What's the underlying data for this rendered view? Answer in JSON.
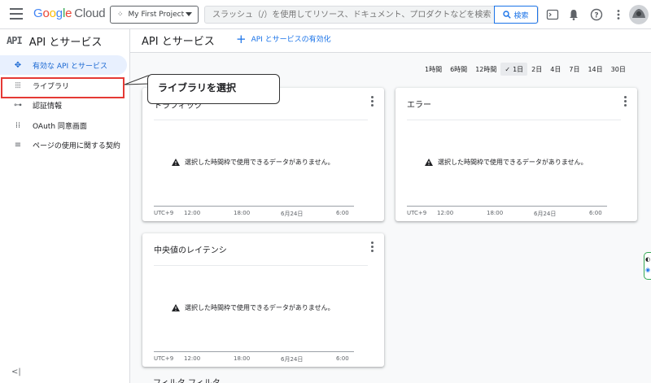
{
  "topbar": {
    "logo_letters": [
      "G",
      "o",
      "o",
      "g",
      "l",
      "e"
    ],
    "logo_suffix": "Cloud",
    "project_name": "My First Project",
    "search_placeholder": "スラッシュ（/）を使用してリソース、ドキュメント、プロダクトなどを検索",
    "search_button": "検索",
    "icons": [
      "terminal-icon",
      "bell-icon",
      "help-icon",
      "more-vert-icon",
      "avatar"
    ]
  },
  "sidebar": {
    "badge": "API",
    "title": "API とサービス",
    "items": [
      {
        "label": "有効な API とサービス",
        "icon": "enabled-apis-icon",
        "active": true
      },
      {
        "label": "ライブラリ",
        "icon": "library-icon",
        "active": false
      },
      {
        "label": "認証情報",
        "icon": "key-icon",
        "active": false
      },
      {
        "label": "OAuth 同意画面",
        "icon": "consent-icon",
        "active": false
      },
      {
        "label": "ページの使用に関する契約",
        "icon": "agreements-icon",
        "active": false
      }
    ],
    "collapse": "<|"
  },
  "main": {
    "title": "API とサービス",
    "enable_link": "API とサービスの有効化",
    "time_ranges": [
      "1時間",
      "6時間",
      "12時間",
      "1日",
      "2日",
      "4日",
      "7日",
      "14日",
      "30日"
    ],
    "selected_range": "1日",
    "cards": [
      {
        "title": "トラフィック",
        "message": "選択した時間枠で使用できるデータがありません。",
        "ticks": [
          "UTC+9",
          "12:00",
          "18:00",
          "6月24日",
          "6:00"
        ]
      },
      {
        "title": "エラー",
        "message": "選択した時間枠で使用できるデータがありません。",
        "ticks": [
          "UTC+9",
          "12:00",
          "18:00",
          "6月24日",
          "6:00"
        ]
      },
      {
        "title": "中央値のレイテンシ",
        "message": "選択した時間枠で使用できるデータがありません。",
        "ticks": [
          "UTC+9",
          "12:00",
          "18:00",
          "6月24日",
          "6:00"
        ]
      }
    ],
    "bottom_title": "フィルタ  フィルタ"
  },
  "annotation": {
    "callout_text": "ライブラリを選択",
    "highlight_color": "#e53935"
  },
  "colors": {
    "accent": "#1a73e8",
    "active_bg": "#e8f0fe",
    "border": "#dadce0"
  }
}
